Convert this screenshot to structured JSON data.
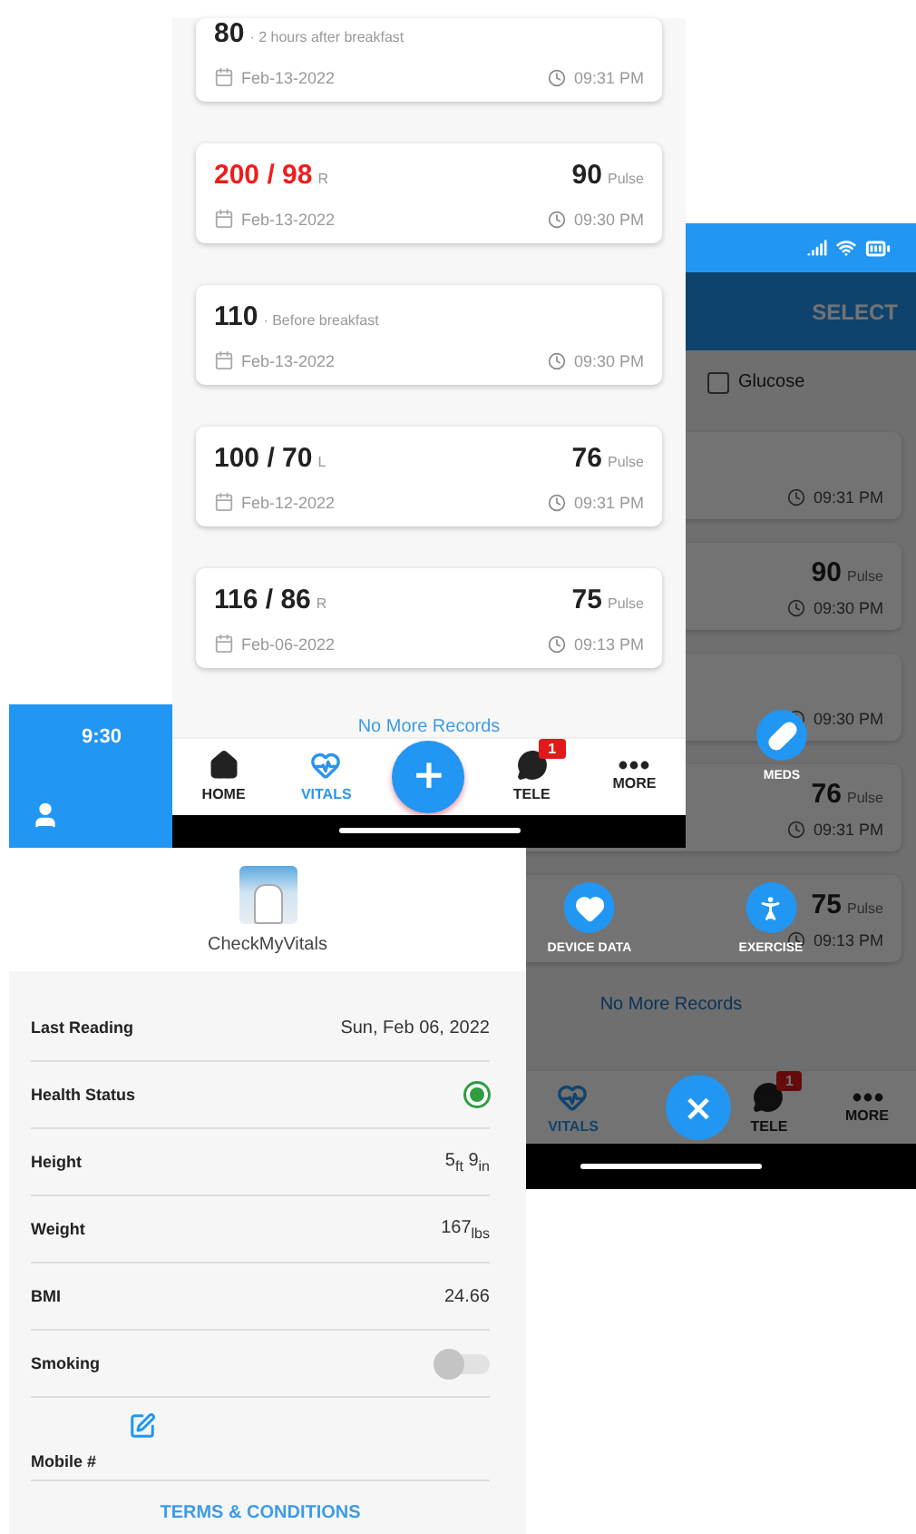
{
  "records_screen": {
    "records": [
      {
        "kind": "glucose",
        "value": "80",
        "note": "· 2 hours after breakfast",
        "alert": false,
        "date": "Feb-13-2022",
        "time": "09:31 PM"
      },
      {
        "kind": "bp",
        "value": "200 / 98",
        "side": "R",
        "alert": true,
        "pulse": "90",
        "pulse_label": "Pulse",
        "date": "Feb-13-2022",
        "time": "09:30 PM"
      },
      {
        "kind": "glucose",
        "value": "110",
        "note": "· Before breakfast",
        "alert": false,
        "date": "Feb-13-2022",
        "time": "09:30 PM"
      },
      {
        "kind": "bp",
        "value": "100 / 70",
        "side": "L",
        "alert": false,
        "pulse": "76",
        "pulse_label": "Pulse",
        "date": "Feb-12-2022",
        "time": "09:31 PM"
      },
      {
        "kind": "bp",
        "value": "116 / 86",
        "side": "R",
        "alert": false,
        "pulse": "75",
        "pulse_label": "Pulse",
        "date": "Feb-06-2022",
        "time": "09:13 PM"
      }
    ],
    "end_note": "No More Records",
    "nav": [
      {
        "label": "HOME",
        "selected": false
      },
      {
        "label": "VITALS",
        "selected": true
      },
      {
        "label": "TELE",
        "selected": false,
        "badge": "1"
      },
      {
        "label": "MORE",
        "selected": false
      }
    ],
    "fab": "+"
  },
  "menu_screen": {
    "header_action": "SELECT",
    "filter": {
      "label": "Glucose",
      "checked": false
    },
    "records": [
      {
        "time": "09:31 PM"
      },
      {
        "pulse": "90",
        "pulse_label": "Pulse",
        "time": "09:30 PM"
      },
      {
        "time": "09:30 PM"
      },
      {
        "pulse": "76",
        "pulse_label": "Pulse",
        "time": "09:31 PM"
      },
      {
        "pulse": "75",
        "pulse_label": "Pulse",
        "time": "09:13 PM"
      }
    ],
    "end_note": "No More Records",
    "nav": [
      {
        "label": "VITALS",
        "selected": true
      },
      {
        "label": "TELE",
        "selected": false,
        "badge": "1"
      },
      {
        "label": "MORE",
        "selected": false
      }
    ],
    "menu": [
      {
        "label": "MEDS"
      },
      {
        "label": "DEVICE DATA"
      },
      {
        "label": "EXERCISE"
      }
    ],
    "close": "×"
  },
  "profile_screen": {
    "status_time": "9:30",
    "app_name": "CheckMyVitals",
    "fields": [
      {
        "kind": "text",
        "label": "Last Reading",
        "value": "Sun, Feb 06, 2022"
      },
      {
        "kind": "status",
        "label": "Health Status",
        "color": "#2e9d3f"
      },
      {
        "kind": "text",
        "label": "Height",
        "value": "5$_{ft}$ 9$_{in}$"
      },
      {
        "kind": "text",
        "label": "Weight",
        "value": "167$_{lbs}$"
      },
      {
        "kind": "text",
        "label": "BMI",
        "value": "24.66"
      },
      {
        "kind": "toggle",
        "label": "Smoking",
        "on": false
      },
      {
        "kind": "edit",
        "label": "Mobile #"
      }
    ],
    "link": "TERMS & CONDITIONS"
  }
}
